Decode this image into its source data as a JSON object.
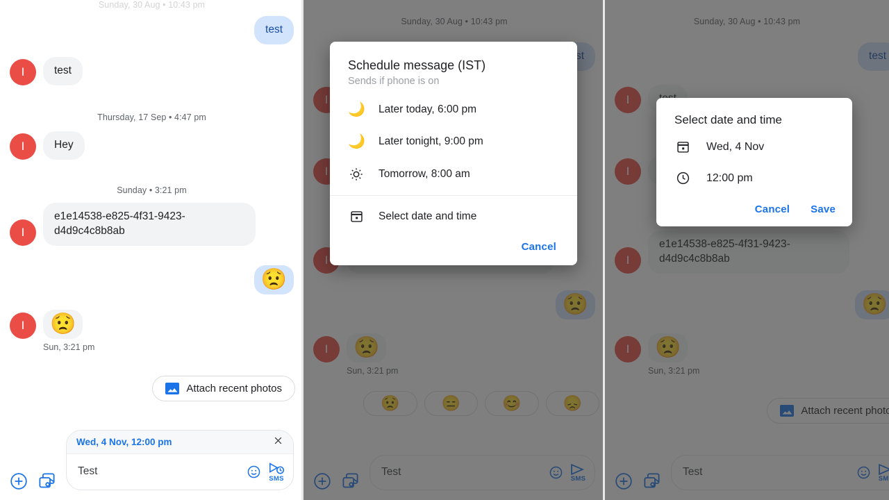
{
  "app": "Google Messages — schedule send flow",
  "panels": [
    {
      "id": "panel-composed",
      "day_separator_top": "Sunday, 30 Aug • 10:43 pm",
      "messages": [
        {
          "side": "out",
          "text": "test",
          "type": "text"
        },
        {
          "side": "in",
          "text": "test",
          "type": "text",
          "avatar": "I"
        },
        {
          "separator": "Thursday, 17 Sep • 4:47 pm"
        },
        {
          "side": "in",
          "text": "Hey",
          "type": "text",
          "avatar": "I"
        },
        {
          "separator": "Sunday • 3:21 pm"
        },
        {
          "side": "in",
          "text": "e1e14538-e825-4f31-9423-d4d9c4c8b8ab",
          "type": "text",
          "avatar": "I"
        },
        {
          "side": "out",
          "text": "😟",
          "type": "emoji"
        },
        {
          "side": "in",
          "text": "😟",
          "type": "emoji",
          "avatar": "I",
          "stamp": "Sun, 3:21 pm"
        }
      ],
      "suggestion_chips": [
        {
          "icon": "photo-icon",
          "label": "Attach recent photos"
        }
      ],
      "composer": {
        "scheduled_label": "Wed, 4 Nov, 12:00 pm",
        "close_icon": "close-icon",
        "plus_icon": "plus-circle-icon",
        "gallery_icon": "gallery-camera-icon",
        "value": "Test",
        "emoji_icon": "emoji-smiley-icon",
        "send_icon": "send-scheduled-icon",
        "send_label": "SMS"
      }
    },
    {
      "id": "panel-schedule-dialog",
      "day_separator_top": "Sunday, 30 Aug • 10:43 pm",
      "messages": [
        {
          "side": "out",
          "text": "test",
          "type": "text"
        },
        {
          "side": "in",
          "text": "test",
          "type": "text",
          "avatar": "I"
        },
        {
          "side": "in",
          "text": "Hey",
          "type": "text",
          "avatar": "I"
        },
        {
          "side": "in",
          "text": "e1e14538-e825-4f31-9423-d4d9c4c8b8ab",
          "type": "text",
          "avatar": "I"
        },
        {
          "side": "out",
          "text": "😟",
          "type": "emoji"
        },
        {
          "side": "in",
          "text": "😟",
          "type": "emoji",
          "avatar": "I",
          "stamp": "Sun, 3:21 pm"
        }
      ],
      "suggestion_chips": [
        {
          "label": "😟"
        },
        {
          "label": "😑"
        },
        {
          "label": "😊"
        },
        {
          "label": "😞"
        }
      ],
      "composer": {
        "plus_icon": "plus-circle-icon",
        "gallery_icon": "gallery-camera-icon",
        "value": "Test",
        "emoji_icon": "emoji-smiley-icon",
        "send_icon": "send-icon",
        "send_label": "SMS"
      },
      "dialog": {
        "title": "Schedule message (IST)",
        "subtitle": "Sends if phone is on",
        "options": [
          {
            "icon": "moon-icon",
            "label": "Later today, 6:00 pm"
          },
          {
            "icon": "moon-icon",
            "label": "Later tonight, 9:00 pm"
          },
          {
            "icon": "sun-icon",
            "label": "Tomorrow, 8:00 am"
          },
          {
            "icon": "calendar-icon",
            "label": "Select date and time"
          }
        ],
        "cancel_label": "Cancel"
      }
    },
    {
      "id": "panel-datetime-dialog",
      "day_separator_top": "Sunday, 30 Aug • 10:43 pm",
      "messages": [
        {
          "side": "out",
          "text": "test",
          "type": "text"
        },
        {
          "side": "in",
          "text": "test",
          "type": "text",
          "avatar": "I"
        },
        {
          "side": "in",
          "text": "Hey",
          "type": "text",
          "avatar": "I"
        },
        {
          "side": "in",
          "text": "e1e14538-e825-4f31-9423-d4d9c4c8b8ab",
          "type": "text",
          "avatar": "I"
        },
        {
          "side": "out",
          "text": "😟",
          "type": "emoji"
        },
        {
          "side": "in",
          "text": "😟",
          "type": "emoji",
          "avatar": "I",
          "stamp": "Sun, 3:21 pm"
        }
      ],
      "suggestion_chips": [
        {
          "icon": "photo-icon",
          "label": "Attach recent photos"
        }
      ],
      "composer": {
        "plus_icon": "plus-circle-icon",
        "gallery_icon": "gallery-camera-icon",
        "value": "Test",
        "emoji_icon": "emoji-smiley-icon",
        "send_icon": "send-icon",
        "send_label": "SMS"
      },
      "dialog": {
        "title": "Select date and time",
        "date_icon": "calendar-icon",
        "date_value": "Wed, 4 Nov",
        "time_icon": "clock-icon",
        "time_value": "12:00 pm",
        "cancel_label": "Cancel",
        "save_label": "Save"
      }
    }
  ],
  "colors": {
    "accent_blue": "#1a73e8",
    "sent_bubble": "#d2e3fc",
    "sent_text": "#174ea6",
    "received_bubble": "#f1f3f4",
    "avatar_red": "#ea4c46",
    "scrim": "#303030",
    "text_primary": "#202124",
    "text_secondary": "#5f6368"
  }
}
